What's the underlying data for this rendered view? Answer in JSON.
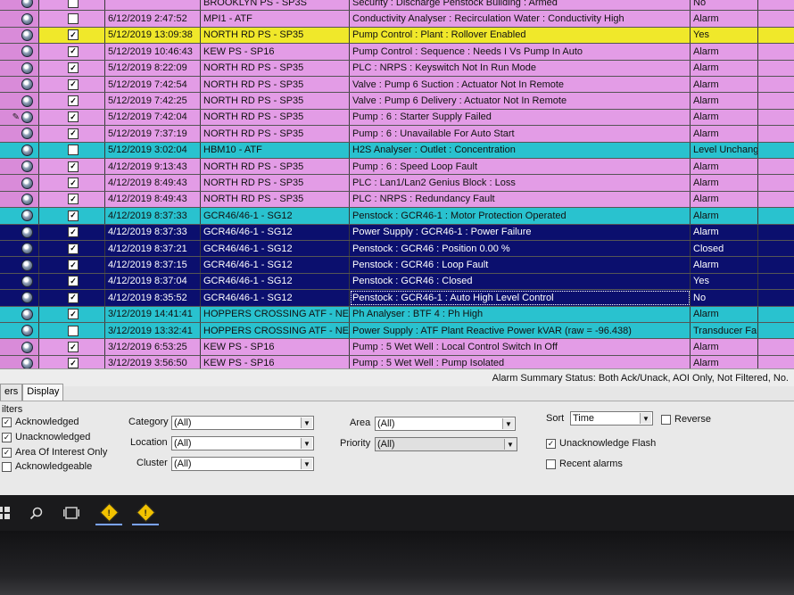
{
  "alarms": [
    {
      "time": "",
      "source": "BROOKLYN PS - SP3S",
      "message": "Security : Discharge Penstock Building : Armed",
      "value": "No",
      "color": "magenta",
      "checked": false
    },
    {
      "time": "6/12/2019 2:47:52",
      "source": "MPI1 - ATF",
      "message": "Conductivity Analyser : Recirculation Water : Conductivity High",
      "value": "Alarm",
      "color": "magenta",
      "checked": false
    },
    {
      "time": "5/12/2019 13:09:38",
      "source": "NORTH RD PS - SP35",
      "message": "Pump Control : Plant : Rollover Enabled",
      "value": "Yes",
      "color": "yellow",
      "checked": true
    },
    {
      "time": "5/12/2019 10:46:43",
      "source": "KEW PS - SP16",
      "message": "Pump Control : Sequence : Needs I Vs Pump In Auto",
      "value": "Alarm",
      "color": "magenta",
      "checked": true
    },
    {
      "time": "5/12/2019 8:22:09",
      "source": "NORTH RD PS - SP35",
      "message": "PLC : NRPS : Keyswitch Not In Run Mode",
      "value": "Alarm",
      "color": "magenta",
      "checked": true
    },
    {
      "time": "5/12/2019 7:42:54",
      "source": "NORTH RD PS - SP35",
      "message": "Valve : Pump 6 Suction : Actuator Not In Remote",
      "value": "Alarm",
      "color": "magenta",
      "checked": true
    },
    {
      "time": "5/12/2019 7:42:25",
      "source": "NORTH RD PS - SP35",
      "message": "Valve : Pump 6 Delivery : Actuator Not In Remote",
      "value": "Alarm",
      "color": "magenta",
      "checked": true
    },
    {
      "time": "5/12/2019 7:42:04",
      "source": "NORTH RD PS - SP35",
      "message": "Pump : 6 : Starter Supply Failed",
      "value": "Alarm",
      "color": "magenta",
      "checked": true,
      "pencil": true
    },
    {
      "time": "5/12/2019 7:37:19",
      "source": "NORTH RD PS - SP35",
      "message": "Pump : 6 : Unavailable For Auto Start",
      "value": "Alarm",
      "color": "magenta",
      "checked": true
    },
    {
      "time": "5/12/2019 3:02:04",
      "source": "HBM10 - ATF",
      "message": "H2S Analyser : Outlet : Concentration",
      "value": "Level Unchang",
      "color": "cyan",
      "checked": false
    },
    {
      "time": "4/12/2019 9:13:43",
      "source": "NORTH RD PS - SP35",
      "message": "Pump : 6 : Speed Loop Fault",
      "value": "Alarm",
      "color": "magenta",
      "checked": true
    },
    {
      "time": "4/12/2019 8:49:43",
      "source": "NORTH RD PS - SP35",
      "message": "PLC : Lan1/Lan2 Genius Block : Loss",
      "value": "Alarm",
      "color": "magenta",
      "checked": true
    },
    {
      "time": "4/12/2019 8:49:43",
      "source": "NORTH RD PS - SP35",
      "message": "PLC : NRPS : Redundancy Fault",
      "value": "Alarm",
      "color": "magenta",
      "checked": true
    },
    {
      "time": "4/12/2019 8:37:33",
      "source": "GCR46/46-1 - SG12",
      "message": "Penstock : GCR46-1 : Motor Protection Operated",
      "value": "Alarm",
      "color": "cyan",
      "checked": true
    },
    {
      "time": "4/12/2019 8:37:33",
      "source": "GCR46/46-1 - SG12",
      "message": "Power Supply : GCR46-1 : Power Failure",
      "value": "Alarm",
      "color": "navy",
      "checked": true
    },
    {
      "time": "4/12/2019 8:37:21",
      "source": "GCR46/46-1 - SG12",
      "message": "Penstock : GCR46 : Position  0.00 %",
      "value": "Closed",
      "color": "navy",
      "checked": true
    },
    {
      "time": "4/12/2019 8:37:15",
      "source": "GCR46/46-1 - SG12",
      "message": "Penstock : GCR46 : Loop Fault",
      "value": "Alarm",
      "color": "navy",
      "checked": true
    },
    {
      "time": "4/12/2019 8:37:04",
      "source": "GCR46/46-1 - SG12",
      "message": "Penstock : GCR46 : Closed",
      "value": "Yes",
      "color": "navy",
      "checked": true
    },
    {
      "time": "4/12/2019 8:35:52",
      "source": "GCR46/46-1 - SG12",
      "message": "Penstock : GCR46-1 : Auto High Level Control",
      "value": "No",
      "color": "navy",
      "checked": true,
      "selected": true
    },
    {
      "time": "3/12/2019 14:41:41",
      "source": "HOPPERS CROSSING ATF - NE",
      "message": "Ph Analyser : BTF 4 : Ph High",
      "value": "Alarm",
      "color": "cyan",
      "checked": true
    },
    {
      "time": "3/12/2019 13:32:41",
      "source": "HOPPERS CROSSING ATF - NE",
      "message": "Power Supply : ATF Plant Reactive Power  kVAR  (raw = -96.438)",
      "value": "Transducer Fa",
      "color": "cyan",
      "checked": false
    },
    {
      "time": "3/12/2019 6:53:25",
      "source": "KEW PS - SP16",
      "message": "Pump : 5 Wet Well : Local Control Switch In Off",
      "value": "Alarm",
      "color": "magenta",
      "checked": true
    },
    {
      "time": "3/12/2019 3:56:50",
      "source": "KEW PS - SP16",
      "message": "Pump : 5 Wet Well : Pump Isolated",
      "value": "Alarm",
      "color": "magenta",
      "checked": true
    }
  ],
  "status_bar": "Alarm Summary Status: Both Ack/Unack, AOI Only, Not Filtered, No.",
  "tabs": [
    "ers",
    "Display"
  ],
  "filters": {
    "heading": "ilters",
    "checks": [
      {
        "label": "Acknowledged",
        "checked": true
      },
      {
        "label": "Unacknowledged",
        "checked": true
      },
      {
        "label": "Area Of Interest Only",
        "checked": true
      },
      {
        "label": "Acknowledgeable",
        "checked": false
      }
    ],
    "category": {
      "label": "Category",
      "value": "(All)"
    },
    "location": {
      "label": "Location",
      "value": "(All)"
    },
    "cluster": {
      "label": "Cluster",
      "value": "(All)"
    },
    "area": {
      "label": "Area",
      "value": "(All)"
    },
    "priority": {
      "label": "Priority",
      "value": "(All)"
    },
    "sort": {
      "label": "Sort",
      "value": "Time"
    },
    "reverse": {
      "label": "Reverse",
      "checked": false
    },
    "unack_flash": {
      "label": "Unacknowledge Flash",
      "checked": true
    },
    "recent": {
      "label": "Recent alarms",
      "checked": false
    }
  },
  "taskbar": {
    "icons": [
      "windows-icon",
      "search-icon",
      "task-view-icon"
    ],
    "apps": [
      "alarm-app-icon",
      "alarm-app-icon"
    ]
  },
  "colors": {
    "magenta": "#e39ce6",
    "yellow": "#f0e82a",
    "cyan": "#29c2cf",
    "navy": "#0b0f6e"
  }
}
